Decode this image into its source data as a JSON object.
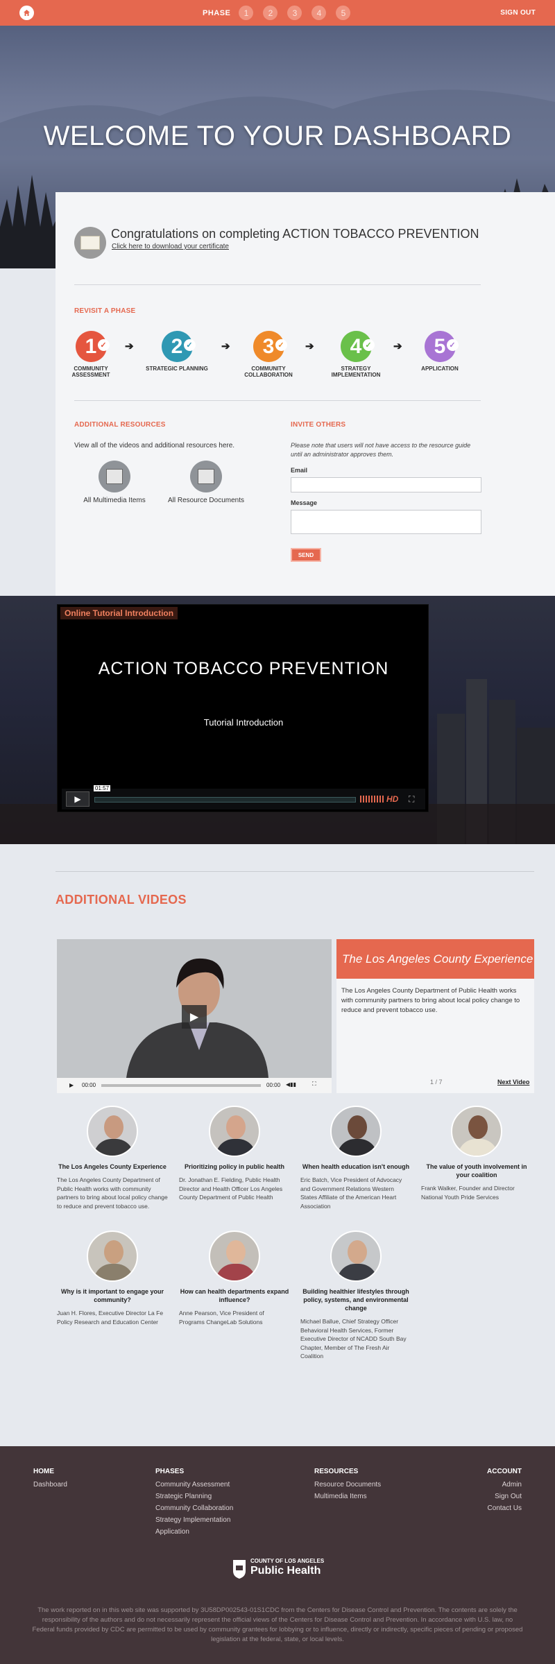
{
  "header": {
    "phase_label": "PHASE",
    "phases": [
      "1",
      "2",
      "3",
      "4",
      "5"
    ],
    "signout": "SIGN OUT"
  },
  "hero": {
    "title": "WELCOME TO YOUR DASHBOARD"
  },
  "certificate": {
    "title": "Congratulations on completing ACTION TOBACCO PREVENTION",
    "link": "Click here to download your certificate"
  },
  "revisit": {
    "title": "REVISIT A PHASE",
    "steps": [
      {
        "num": "1",
        "label": "COMMUNITY ASSESSMENT",
        "color": "#e5563f"
      },
      {
        "num": "2",
        "label": "STRATEGIC PLANNING",
        "color": "#2f98b3"
      },
      {
        "num": "3",
        "label": "COMMUNITY COLLABORATION",
        "color": "#ef8a2a"
      },
      {
        "num": "4",
        "label": "STRATEGY IMPLEMENTATION",
        "color": "#6ac04a"
      },
      {
        "num": "5",
        "label": "APPLICATION",
        "color": "#a874d4"
      }
    ]
  },
  "resources": {
    "title": "ADDITIONAL RESOURCES",
    "text": "View all of the videos and additional resources here.",
    "multimedia": "All Multimedia Items",
    "documents": "All Resource Documents"
  },
  "invite": {
    "title": "INVITE OTHERS",
    "note": "Please note that users will not have access to the resource guide until an administrator approves them.",
    "email_label": "Email",
    "message_label": "Message",
    "send": "SEND"
  },
  "tutorial": {
    "label": "Online Tutorial Introduction",
    "title": "ACTION TOBACCO PREVENTION",
    "subtitle": "Tutorial Introduction",
    "time": "01:57",
    "hd": "HD"
  },
  "additional_videos": {
    "title": "ADDITIONAL VIDEOS",
    "featured": {
      "heading": "The Los Angeles County Experience",
      "description": "The Los Angeles County Department of Public Health works with community partners to bring about local policy change to reduce and prevent tobacco use.",
      "count": "1 / 7",
      "next": "Next Video",
      "time_start": "00:00",
      "time_end": "00:00"
    },
    "items": [
      {
        "title": "The Los Angeles County Experience",
        "desc": "The Los Angeles County Department of Public Health works with community partners to bring about local policy change to reduce and prevent tobacco use."
      },
      {
        "title": "Prioritizing policy in public health",
        "desc": "Dr. Jonathan E. Fielding, Public Health Director and Health Officer Los Angeles County Department of Public Health"
      },
      {
        "title": "When health education isn't enough",
        "desc": "Eric Batch, Vice President of Advocacy and Government Relations Western States Affiliate of the American Heart Association"
      },
      {
        "title": "The value of youth involvement in your coalition",
        "desc": "Frank Walker, Founder and Director National Youth Pride Services"
      },
      {
        "title": "Why is it important to engage your community?",
        "desc": "Juan H. Flores, Executive Director La Fe Policy Research and Education Center"
      },
      {
        "title": "How can health departments expand influence?",
        "desc": "Anne Pearson, Vice President of Programs ChangeLab Solutions"
      },
      {
        "title": "Building healthier lifestyles through policy, systems, and environmental change",
        "desc": "Michael Ballue, Chief Strategy Officer Behavioral Health Services, Former Executive Director of NCADD South Bay Chapter, Member of The Fresh Air Coalition"
      }
    ]
  },
  "footer": {
    "home": {
      "title": "HOME",
      "links": [
        "Dashboard"
      ]
    },
    "phases": {
      "title": "PHASES",
      "links": [
        "Community Assessment",
        "Strategic Planning",
        "Community Collaboration",
        "Strategy Implementation",
        "Application"
      ]
    },
    "resources": {
      "title": "RESOURCES",
      "links": [
        "Resource Documents",
        "Multimedia Items"
      ]
    },
    "account": {
      "title": "ACCOUNT",
      "links": [
        "Admin",
        "Sign Out",
        "Contact Us"
      ]
    },
    "logo_top": "COUNTY OF LOS ANGELES",
    "logo_main": "Public Health",
    "disclaimer": "The work reported on in this web site was supported by 3U58DP002543-01S1CDC from the Centers for Disease Control and Prevention. The contents are solely the responsibility of the authors and do not necessarily represent the official views of the Centers for Disease Control and Prevention. In accordance with U.S. law, no Federal funds provided by CDC are permitted to be used by community grantees for lobbying or to influence, directly or indirectly, specific pieces of pending or proposed legislation at the federal, state, or local levels."
  },
  "colors": {
    "accent": "#e5684f",
    "footer_bg": "#433539"
  }
}
